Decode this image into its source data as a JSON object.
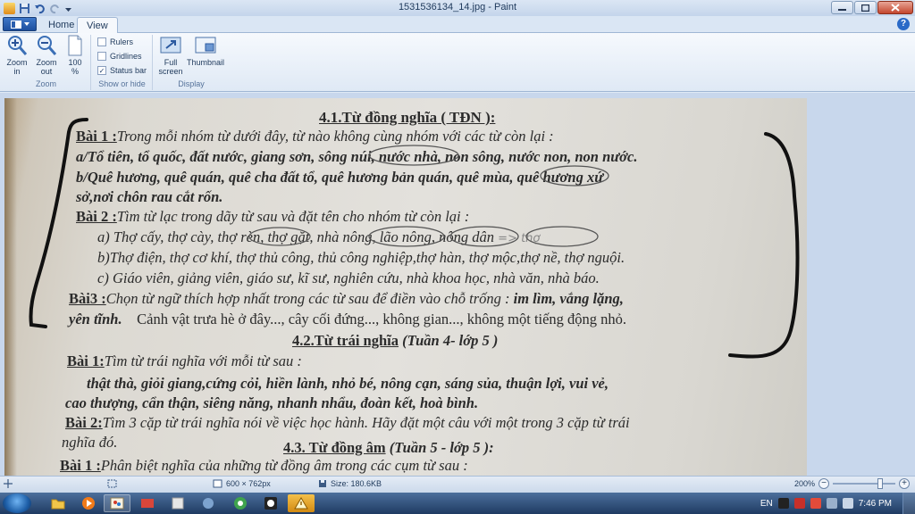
{
  "window": {
    "title": "1531536134_14.jpg - Paint"
  },
  "tabs": [
    {
      "label": "Home"
    },
    {
      "label": "View"
    }
  ],
  "ribbon": {
    "zoom_group": {
      "label": "Zoom",
      "zoom_in": "Zoom in",
      "zoom_out": "Zoom out",
      "hundred": "100 %"
    },
    "show_group": {
      "label": "Show or hide",
      "rulers": "Rulers",
      "gridlines": "Gridlines",
      "statusbar": "Status bar"
    },
    "display_group": {
      "label": "Display",
      "fullscreen": "Full screen",
      "thumbnail": "Thumbnail"
    }
  },
  "document": {
    "h1": "4.1.Từ đồng nghĩa ( TĐN ):",
    "b1_label": "Bài 1 :",
    "b1_text": "Trong mỗi nhóm từ dưới đây, từ nào không cùng nhóm với các từ còn lại :",
    "b1_a": "a/Tổ tiên, tổ quốc, đất nước, giang sơn, sông núi, nước nhà, non sông, nước non, non nước.",
    "b1_b": "b/Quê hương, quê quán, quê cha đất tổ, quê hương bản quán, quê mùa, quê hương xứ",
    "b1_b2": "sở,nơi chôn rau cắt rốn.",
    "b2_label": "Bài 2 :",
    "b2_text": "Tìm từ lạc trong dãy từ sau và đặt tên cho nhóm từ còn lại :",
    "b2_a": "a) Thợ cấy, thợ cày, thợ rèn, thợ gặt, nhà nông, lão nông, nông dân",
    "b2_a_note": "=> thợ",
    "b2_b": "b)Thợ điện, thợ cơ khí, thợ thủ công, thủ công nghiệp,thợ hàn, thợ mộc,thợ nề, thợ nguội.",
    "b2_c": "c) Giáo viên, giảng viên, giáo sư, kĩ sư, nghiên cứu, nhà khoa học, nhà văn, nhà báo.",
    "b3_label": "Bài3 :",
    "b3_text": "Chọn từ ngữ thích hợp nhất trong các từ sau để điền vào chỗ trống :",
    "b3_words": "im lìm, vắng lặng,",
    "b3_words2": "yên tĩnh.",
    "b3_sentence": "Cảnh vật trưa hè ở đây..., cây cối đứng..., không gian..., không một tiếng động nhỏ.",
    "h2": "4.2.Từ trái nghĩa",
    "h2_sub": "(Tuần 4- lớp 5 )",
    "c1_label": "Bài 1:",
    "c1_text": "Tìm từ trái nghĩa với mỗi từ sau :",
    "c1_words": "thật thà, giỏi giang,cứng cỏi, hiền lành, nhỏ bé, nông cạn, sáng sủa, thuận lợi, vui vẻ,",
    "c1_words2": "cao thượng, cẩn thận, siêng năng, nhanh nhẩu, đoàn kết, hoà bình.",
    "c2_label": "Bài 2:",
    "c2_text": "Tìm 3 cặp từ trái nghĩa nói về việc học hành. Hãy đặt một câu với một trong 3 cặp từ trái",
    "c2_text2": "nghĩa đó.",
    "h3": "4.3. Từ đồng âm",
    "h3_sub": "(Tuần 5 - lớp 5 ):",
    "d1_label": "Bài 1 :",
    "d1_text": "Phân biệt nghĩa của những từ đồng âm trong các cụm từ sau :"
  },
  "status": {
    "dimensions": "600 × 762px",
    "size": "Size: 180.6KB",
    "zoom": "200%"
  },
  "taskbar": {
    "lang": "EN",
    "time": "7:46 PM"
  }
}
